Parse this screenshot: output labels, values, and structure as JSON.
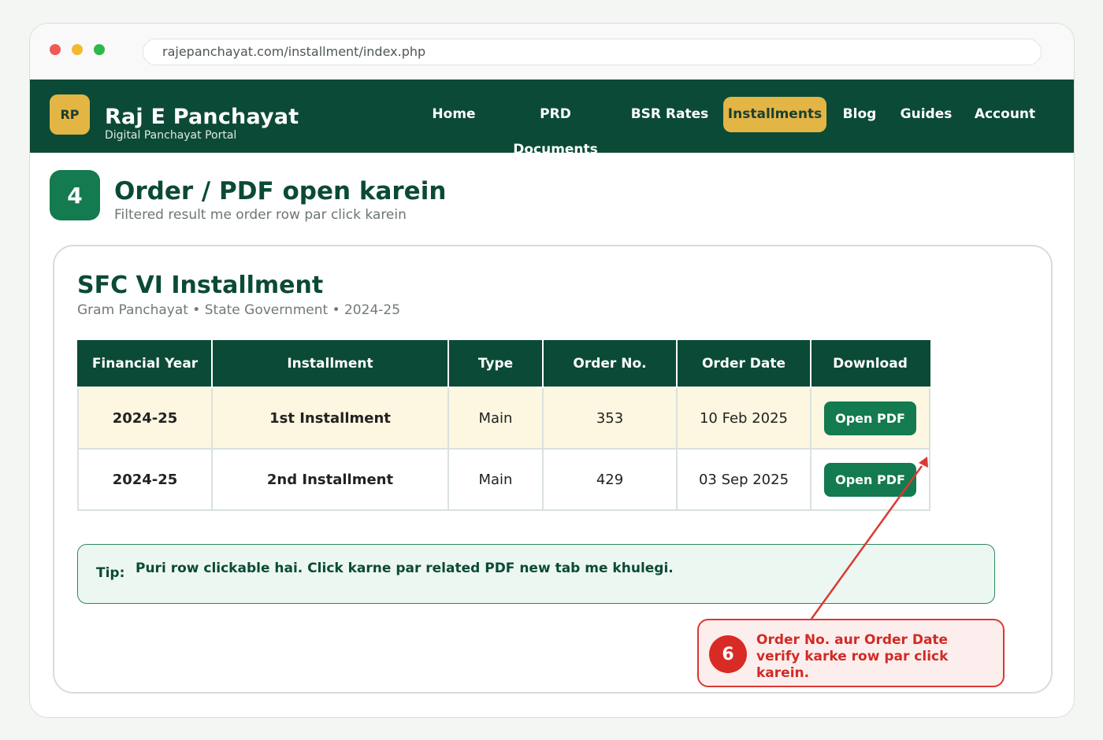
{
  "browser": {
    "url": "rajepanchayat.com/installment/index.php"
  },
  "header": {
    "logo_text": "RP",
    "site_title": "Raj E Panchayat",
    "site_subtitle": "Digital Panchayat Portal",
    "nav": [
      {
        "label": "Home"
      },
      {
        "label": "PRD Documents"
      },
      {
        "label": "BSR Rates"
      },
      {
        "label": "Installments",
        "active": true
      },
      {
        "label": "Blog"
      },
      {
        "label": "Guides"
      },
      {
        "label": "Account"
      }
    ]
  },
  "step": {
    "number": "4",
    "title": "Order / PDF open karein",
    "subtitle": "Filtered result me order row par click karein"
  },
  "card": {
    "title": "SFC VI Installment",
    "meta": "Gram Panchayat  •  State Government  •  2024-25",
    "table": {
      "headers": [
        "Financial Year",
        "Installment",
        "Type",
        "Order No.",
        "Order Date",
        "Download"
      ],
      "rows": [
        {
          "year": "2024-25",
          "installment": "1st Installment",
          "type": "Main",
          "order_no": "353",
          "order_date": "10 Feb 2025",
          "download": "Open PDF",
          "highlighted": true
        },
        {
          "year": "2024-25",
          "installment": "2nd Installment",
          "type": "Main",
          "order_no": "429",
          "order_date": "03 Sep 2025",
          "download": "Open PDF",
          "highlighted": false
        }
      ]
    },
    "tip": {
      "label": "Tip:",
      "text": "Puri row clickable hai. Click karne par related PDF new tab me khulegi."
    }
  },
  "callout": {
    "number": "6",
    "text": "Order No. aur Order Date verify karke row par click karein."
  },
  "colors": {
    "primary": "#0b4a36",
    "accent": "#e2b545",
    "button": "#147a4f",
    "highlight_row": "#fdf6e0",
    "callout_red": "#d93a32"
  }
}
